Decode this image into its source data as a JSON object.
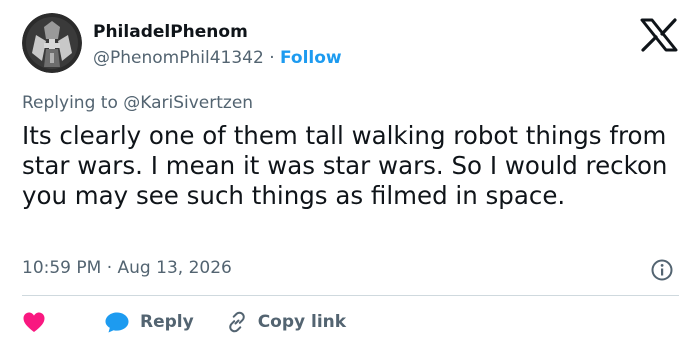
{
  "author": {
    "display_name": "PhiladelPhenom",
    "handle": "@PhenomPhil41342",
    "separator": "·",
    "follow_label": "Follow"
  },
  "replying": {
    "prefix": "Replying to",
    "mention": "@KariSivertzen"
  },
  "tweet": {
    "text": "Its clearly one of them tall walking robot things from star wars. I mean it was star wars. So I would reckon you may see such things as filmed in space.",
    "timestamp": "10:59 PM · Aug 13, 2026"
  },
  "actions": {
    "reply_label": "Reply",
    "copy_link_label": "Copy link"
  },
  "colors": {
    "link": "#1d9bf0",
    "like": "#f91880",
    "secondary": "#536471",
    "text": "#0f1419"
  },
  "icons": [
    "avatar-knight-image",
    "x-logo-icon",
    "info-icon",
    "heart-icon",
    "reply-bubble-icon",
    "link-icon"
  ]
}
